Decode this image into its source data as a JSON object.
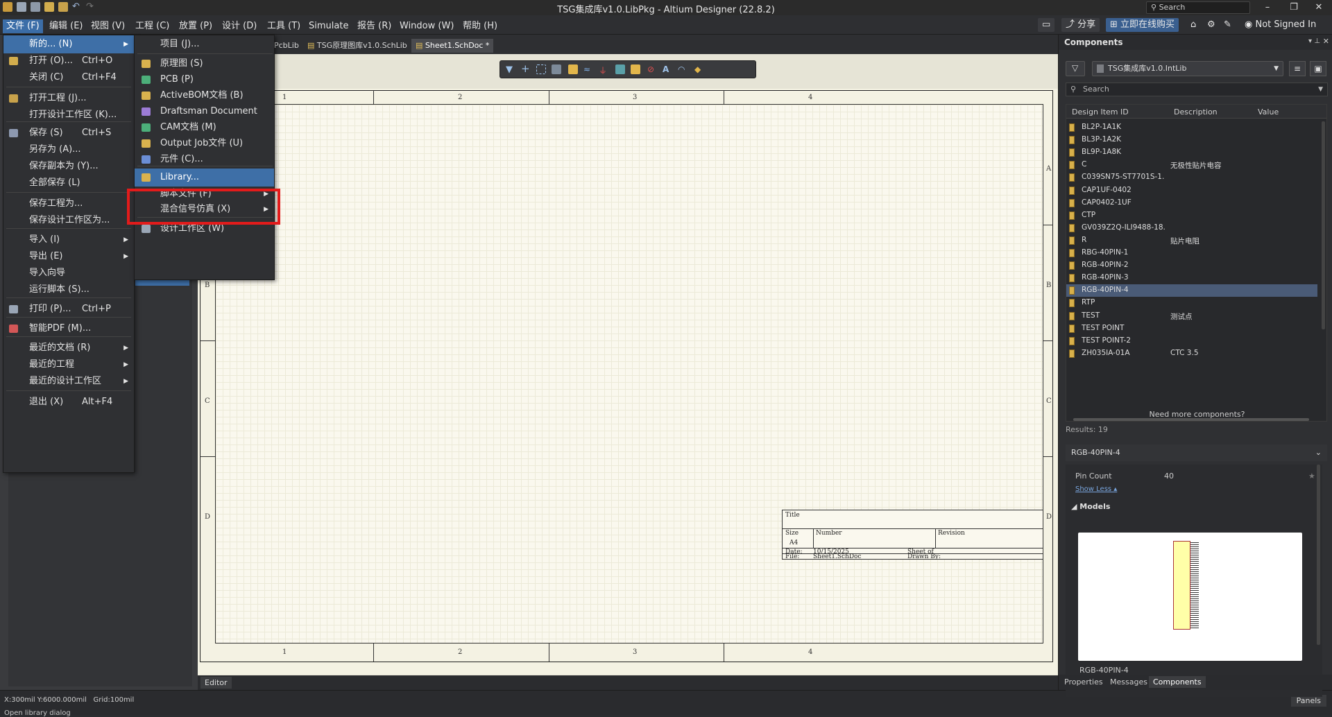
{
  "window": {
    "title": "TSG集成库v1.0.LibPkg - Altium Designer (22.8.2)",
    "search_label": "Search",
    "minimize": "–",
    "maximize": "❐",
    "close": "✕"
  },
  "menubar": {
    "items": [
      "文件 (F)",
      "编辑 (E)",
      "视图 (V)",
      "工程 (C)",
      "放置 (P)",
      "设计 (D)",
      "工具 (T)",
      "Simulate",
      "报告 (R)",
      "Window (W)",
      "帮助 (H)"
    ],
    "share": "分享",
    "buy": "立即在线购买",
    "signin": "Not Signed In"
  },
  "doc_tabs": [
    "PcbLib",
    "TSG原理图库v1.0.SchLib",
    "Sheet1.SchDoc *"
  ],
  "file_menu": {
    "items": [
      {
        "label": "新的... (N)",
        "shortcut": "",
        "arrow": true
      },
      {
        "label": "打开 (O)...",
        "shortcut": "Ctrl+O",
        "arrow": false
      },
      {
        "label": "关闭 (C)",
        "shortcut": "Ctrl+F4",
        "arrow": false
      },
      {
        "label": "打开工程 (J)...",
        "shortcut": "",
        "arrow": false
      },
      {
        "label": "打开设计工作区 (K)...",
        "shortcut": "",
        "arrow": false
      },
      {
        "label": "保存 (S)",
        "shortcut": "Ctrl+S",
        "arrow": false
      },
      {
        "label": "另存为 (A)...",
        "shortcut": "",
        "arrow": false
      },
      {
        "label": "保存副本为 (Y)...",
        "shortcut": "",
        "arrow": false
      },
      {
        "label": "全部保存 (L)",
        "shortcut": "",
        "arrow": false
      },
      {
        "label": "保存工程为...",
        "shortcut": "",
        "arrow": false
      },
      {
        "label": "保存设计工作区为...",
        "shortcut": "",
        "arrow": false
      },
      {
        "label": "导入 (I)",
        "shortcut": "",
        "arrow": true
      },
      {
        "label": "导出 (E)",
        "shortcut": "",
        "arrow": true
      },
      {
        "label": "导入向导",
        "shortcut": "",
        "arrow": false
      },
      {
        "label": "运行脚本 (S)...",
        "shortcut": "",
        "arrow": false
      },
      {
        "label": "打印 (P)...",
        "shortcut": "Ctrl+P",
        "arrow": false
      },
      {
        "label": "智能PDF (M)...",
        "shortcut": "",
        "arrow": false
      },
      {
        "label": "最近的文档 (R)",
        "shortcut": "",
        "arrow": true
      },
      {
        "label": "最近的工程",
        "shortcut": "",
        "arrow": true
      },
      {
        "label": "最近的设计工作区",
        "shortcut": "",
        "arrow": true
      },
      {
        "label": "退出 (X)",
        "shortcut": "Alt+F4",
        "arrow": false
      }
    ]
  },
  "sub_menu": {
    "items": [
      {
        "label": "项目 (J)...",
        "arrow": false
      },
      {
        "label": "原理图 (S)",
        "arrow": false
      },
      {
        "label": "PCB (P)",
        "arrow": false
      },
      {
        "label": "ActiveBOM文档 (B)",
        "arrow": false
      },
      {
        "label": "Draftsman Document",
        "arrow": false
      },
      {
        "label": "CAM文档 (M)",
        "arrow": false
      },
      {
        "label": "Output Job文件 (U)",
        "arrow": false
      },
      {
        "label": "元件 (C)...",
        "arrow": false
      },
      {
        "label": "Library...",
        "arrow": false
      },
      {
        "label": "脚本文件 (F)",
        "arrow": true
      },
      {
        "label": "混合信号仿真 (X)",
        "arrow": true
      },
      {
        "label": "设计工作区 (W)",
        "arrow": false
      }
    ]
  },
  "sheet": {
    "col_labels": [
      "1",
      "2",
      "3",
      "4"
    ],
    "row_labels": [
      "A",
      "B",
      "C",
      "D"
    ],
    "title_block": {
      "title": "Title",
      "size": "Size",
      "size_value": "A4",
      "number": "Number",
      "revision": "Revision",
      "date": "Date:",
      "date_value": "10/15/2025",
      "file": "File:",
      "file_value": "Sheet1.SchDoc",
      "sheet_of": "Sheet  of",
      "drawn_by": "Drawn By:"
    }
  },
  "editor_tab": "Editor",
  "status": {
    "coords": "X:300mil Y:6000.000mil",
    "grid": "Grid:100mil",
    "message": "Open library dialog",
    "panels": "Panels"
  },
  "components_panel": {
    "title": "Components",
    "library": "TSG集成库v1.0.IntLib",
    "search_placeholder": "Search",
    "columns": [
      "Design Item ID",
      "Description",
      "Value"
    ],
    "rows": [
      {
        "id": "BL2P-1A1K",
        "desc": ""
      },
      {
        "id": "BL3P-1A2K",
        "desc": ""
      },
      {
        "id": "BL9P-1A8K",
        "desc": ""
      },
      {
        "id": "C",
        "desc": "无极性贴片电容"
      },
      {
        "id": "C039SN75-ST7701S-1...",
        "desc": ""
      },
      {
        "id": "CAP1UF-0402",
        "desc": ""
      },
      {
        "id": "CAP0402-1UF",
        "desc": ""
      },
      {
        "id": "CTP",
        "desc": ""
      },
      {
        "id": "GV039Z2Q-ILI9488-18...",
        "desc": ""
      },
      {
        "id": "R",
        "desc": "贴片电阻"
      },
      {
        "id": "RBG-40PIN-1",
        "desc": ""
      },
      {
        "id": "RGB-40PIN-2",
        "desc": ""
      },
      {
        "id": "RGB-40PIN-3",
        "desc": ""
      },
      {
        "id": "RGB-40PIN-4",
        "desc": ""
      },
      {
        "id": "RTP",
        "desc": ""
      },
      {
        "id": "TEST",
        "desc": "测试点"
      },
      {
        "id": "TEST POINT",
        "desc": ""
      },
      {
        "id": "TEST POINT-2",
        "desc": ""
      },
      {
        "id": "ZH035IA-01A",
        "desc": "CTC 3.5"
      }
    ],
    "selected_index": 13,
    "need_more": "Need more components?",
    "results": "Results: 19",
    "detail_title": "RGB-40PIN-4",
    "pin_count_label": "Pin Count",
    "pin_count_value": "40",
    "show_less": "Show Less ▴",
    "models_label": "◢ Models",
    "model_name": "RGB-40PIN-4"
  },
  "panel_tabs": [
    "Properties",
    "Messages",
    "Components"
  ],
  "colors": {
    "menu_highlight": "#3e6fa7",
    "annotation_red": "#e31b1b",
    "selection_row": "#4a5b77",
    "sheet_paper": "#faf8ee"
  }
}
